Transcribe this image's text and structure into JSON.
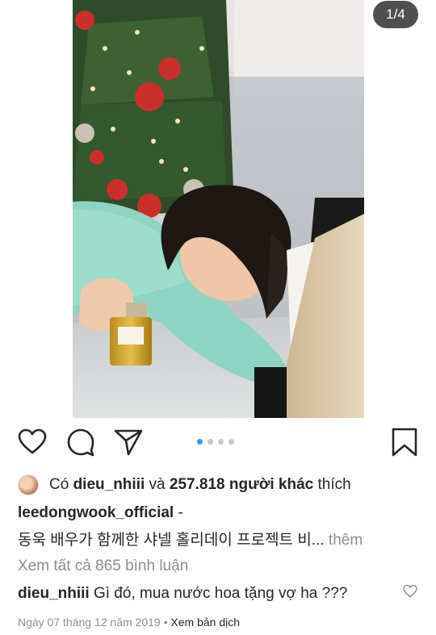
{
  "post": {
    "counter": "1/4",
    "likes": {
      "prefix": "Có",
      "user": "dieu_nhiii",
      "conj": "và",
      "others": "257.818 người khác",
      "suffix": "thích"
    },
    "caption": {
      "username": "leedongwook_official",
      "dash": "-",
      "text": "동욱 배우가 함께한 샤넬 홀리데이 프로젝트 비",
      "ellipsis": "...",
      "more": "thêm"
    },
    "view_all_comments": "Xem tất cả 865 bình luận",
    "comment": {
      "username": "dieu_nhiii",
      "text": "Gì đó, mua nước hoa tặng vợ ha ???"
    },
    "date": "Ngày 07 tháng 12 năm 2019",
    "separator": "•",
    "translate": "Xem bản dịch",
    "carousel": {
      "total": 4,
      "active": 1
    }
  },
  "icons": {
    "like": "heart-icon",
    "comment": "comment-bubble-icon",
    "share": "paper-plane-icon",
    "save": "bookmark-icon",
    "comment_like": "heart-outline-icon"
  },
  "colors": {
    "text": "#262626",
    "muted": "#8e8e8e",
    "accent": "#3897f0"
  }
}
